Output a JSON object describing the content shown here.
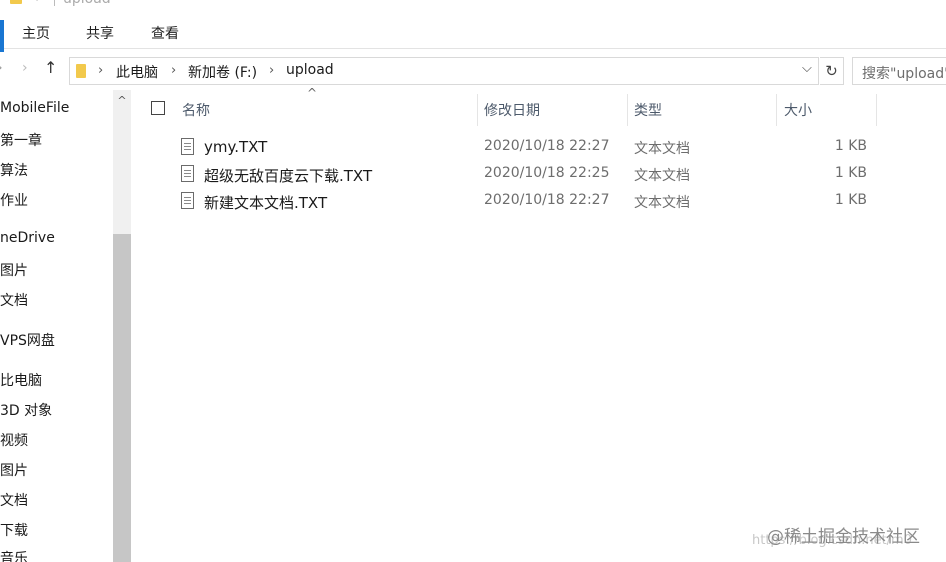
{
  "window": {
    "title": "upload"
  },
  "ribbon": {
    "tabs": [
      "主页",
      "共享",
      "查看"
    ]
  },
  "address": {
    "crumbs": [
      "此电脑",
      "新加卷 (F:)",
      "upload"
    ],
    "back_icon": "back-arrow-icon",
    "forward_icon": "forward-arrow-icon",
    "up_icon": "up-arrow-icon",
    "refresh_icon": "refresh-icon",
    "dropdown_icon": "chevron-down-icon"
  },
  "search": {
    "placeholder": "搜索\"upload\""
  },
  "navpane": {
    "items": [
      "MobileFile",
      "第一章",
      "算法",
      "作业",
      "neDrive",
      "图片",
      "文档",
      "VPS网盘",
      "比电脑",
      "3D 对象",
      "视频",
      "图片",
      "文档",
      "下载",
      "音乐"
    ]
  },
  "columns": {
    "name": "名称",
    "modified": "修改日期",
    "type": "类型",
    "size": "大小"
  },
  "files": [
    {
      "name": "ymy.TXT",
      "modified": "2020/10/18 22:27",
      "type": "文本文档",
      "size": "1 KB"
    },
    {
      "name": "超级无敌百度云下载.TXT",
      "modified": "2020/10/18 22:25",
      "type": "文本文档",
      "size": "1 KB"
    },
    {
      "name": "新建文本文档.TXT",
      "modified": "2020/10/18 22:27",
      "type": "文本文档",
      "size": "1 KB"
    }
  ],
  "watermark": {
    "text": "@稀土掘金技术社区",
    "url": "https://blog.csdn.net/m0"
  },
  "colors": {
    "accent": "#1976d2",
    "folder": "#f2c94c",
    "header_text": "#4d5a6b",
    "muted_text": "#6d6d6d"
  }
}
